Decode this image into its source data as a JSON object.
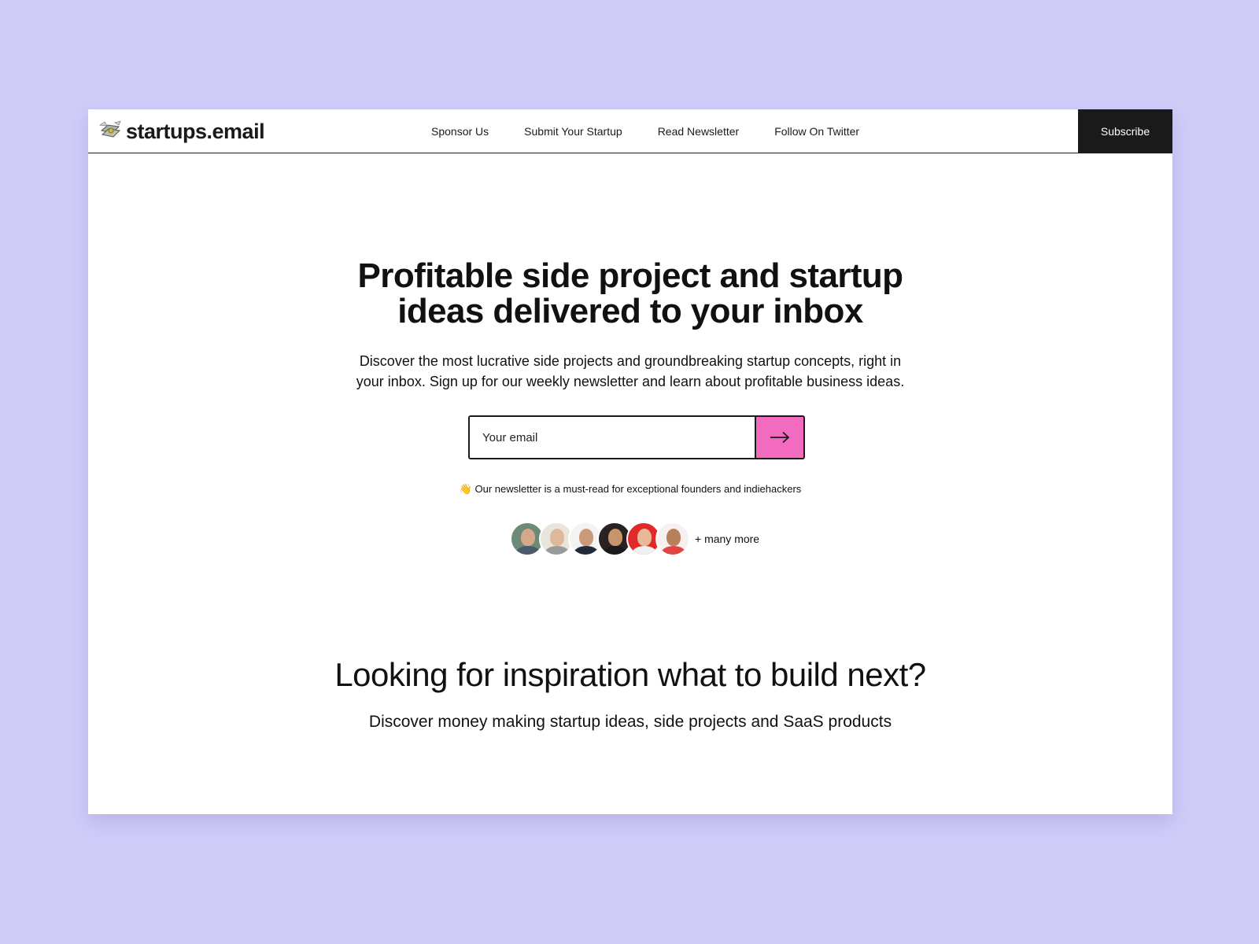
{
  "brand": {
    "name": "startups.email"
  },
  "nav": {
    "items": [
      {
        "label": "Sponsor Us"
      },
      {
        "label": "Submit Your Startup"
      },
      {
        "label": "Read Newsletter"
      },
      {
        "label": "Follow On Twitter"
      }
    ],
    "subscribe_label": "Subscribe"
  },
  "hero": {
    "title_line1": "Profitable side project and startup",
    "title_line2": "ideas delivered to your inbox",
    "subtitle_line1": "Discover the most lucrative side projects and groundbreaking startup concepts, right in",
    "subtitle_line2": "your inbox. Sign up for our weekly newsletter and learn about profitable business ideas.",
    "email_placeholder": "Your email",
    "submit_icon": "arrow-right-icon",
    "tagline_emoji": "👋",
    "tagline": "Our newsletter is a must-read for exceptional founders and indiehackers",
    "many_more": "+ many more"
  },
  "section": {
    "title": "Looking for inspiration what to build next?",
    "subtitle": "Discover money making startup ideas, side projects and SaaS products"
  },
  "colors": {
    "background": "#cfccf8",
    "accent": "#f26bbf",
    "dark": "#1a1a1a"
  }
}
